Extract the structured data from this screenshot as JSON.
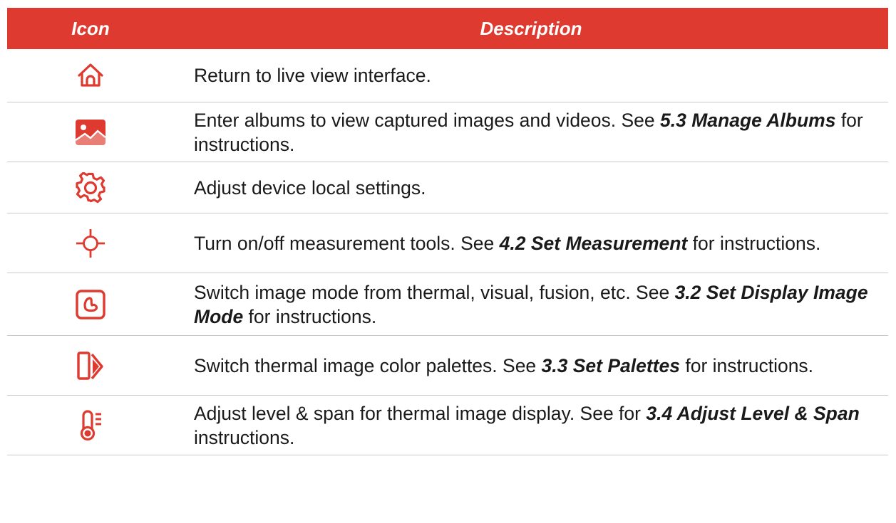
{
  "table": {
    "headers": {
      "icon": "Icon",
      "description": "Description"
    },
    "rows": [
      {
        "icon": "home-icon",
        "text": "Return to live view interface.",
        "ref": "",
        "after": ""
      },
      {
        "icon": "album-icon",
        "text": "Enter albums to view captured images and videos. See ",
        "ref": "5.3 Manage Albums",
        "after": " for instructions."
      },
      {
        "icon": "gear-icon",
        "text": "Adjust device local settings.",
        "ref": "",
        "after": ""
      },
      {
        "icon": "crosshair-icon",
        "text": "Turn on/off measurement tools. See ",
        "ref": "4.2 Set Measurement",
        "after": " for instructions."
      },
      {
        "icon": "image-mode-icon",
        "text": "Switch image mode from thermal, visual, fusion, etc. See ",
        "ref": "3.2 Set Display Image Mode",
        "after": " for instructions."
      },
      {
        "icon": "palette-icon",
        "text": "Switch thermal image color palettes. See ",
        "ref": "3.3 Set Palettes",
        "after": " for instructions."
      },
      {
        "icon": "thermometer-icon",
        "text": "Adjust level & span for thermal image display. See for ",
        "ref": "3.4 Adjust Level & Span",
        "after": " instructions."
      }
    ]
  },
  "colors": {
    "accent": "#de3a2f",
    "text": "#1a1a1a",
    "divider": "#c9c9c9"
  }
}
